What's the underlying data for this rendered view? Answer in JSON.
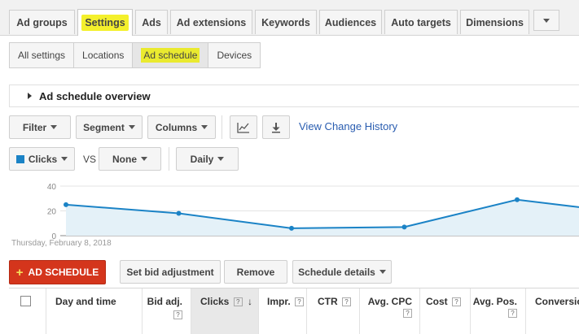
{
  "tabs": [
    {
      "label": "Ad groups"
    },
    {
      "label": "Settings",
      "active": true
    },
    {
      "label": "Ads"
    },
    {
      "label": "Ad extensions"
    },
    {
      "label": "Keywords"
    },
    {
      "label": "Audiences"
    },
    {
      "label": "Auto targets"
    },
    {
      "label": "Dimensions"
    }
  ],
  "subtabs": [
    {
      "label": "All settings"
    },
    {
      "label": "Locations"
    },
    {
      "label": "Ad schedule",
      "active": true
    },
    {
      "label": "Devices"
    }
  ],
  "overview": {
    "title": "Ad schedule overview"
  },
  "toolbar": {
    "filter": "Filter",
    "segment": "Segment",
    "columns": "Columns",
    "chart_icon": "line-chart-icon",
    "download_icon": "download-icon",
    "history_link": "View Change History"
  },
  "chart_controls": {
    "metric1": "Clicks",
    "vs": "VS",
    "metric2": "None",
    "period": "Daily",
    "metric_color": "#1b83c6"
  },
  "chart_data": {
    "type": "area",
    "x_label_first": "Thursday, February 8, 2018",
    "yticks": [
      "40",
      "20",
      "0"
    ],
    "ylim": [
      0,
      40
    ],
    "series": [
      {
        "values": [
          25,
          18,
          6,
          7,
          29,
          23
        ]
      }
    ],
    "line_color": "#1b83c6",
    "fill_color": "#e4f1f8"
  },
  "actions": {
    "add": "AD SCHEDULE",
    "bid": "Set bid adjustment",
    "remove": "Remove",
    "details": "Schedule details"
  },
  "table": {
    "columns": [
      {
        "label": "Day and time"
      },
      {
        "label": "Bid adj."
      },
      {
        "label": "Clicks"
      },
      {
        "label": "Impr."
      },
      {
        "label": "CTR"
      },
      {
        "label": "Avg. CPC"
      },
      {
        "label": "Cost"
      },
      {
        "label": "Avg. Pos."
      },
      {
        "label": "Conversions"
      }
    ],
    "help_glyph": "?",
    "sort_glyph": "↓"
  }
}
